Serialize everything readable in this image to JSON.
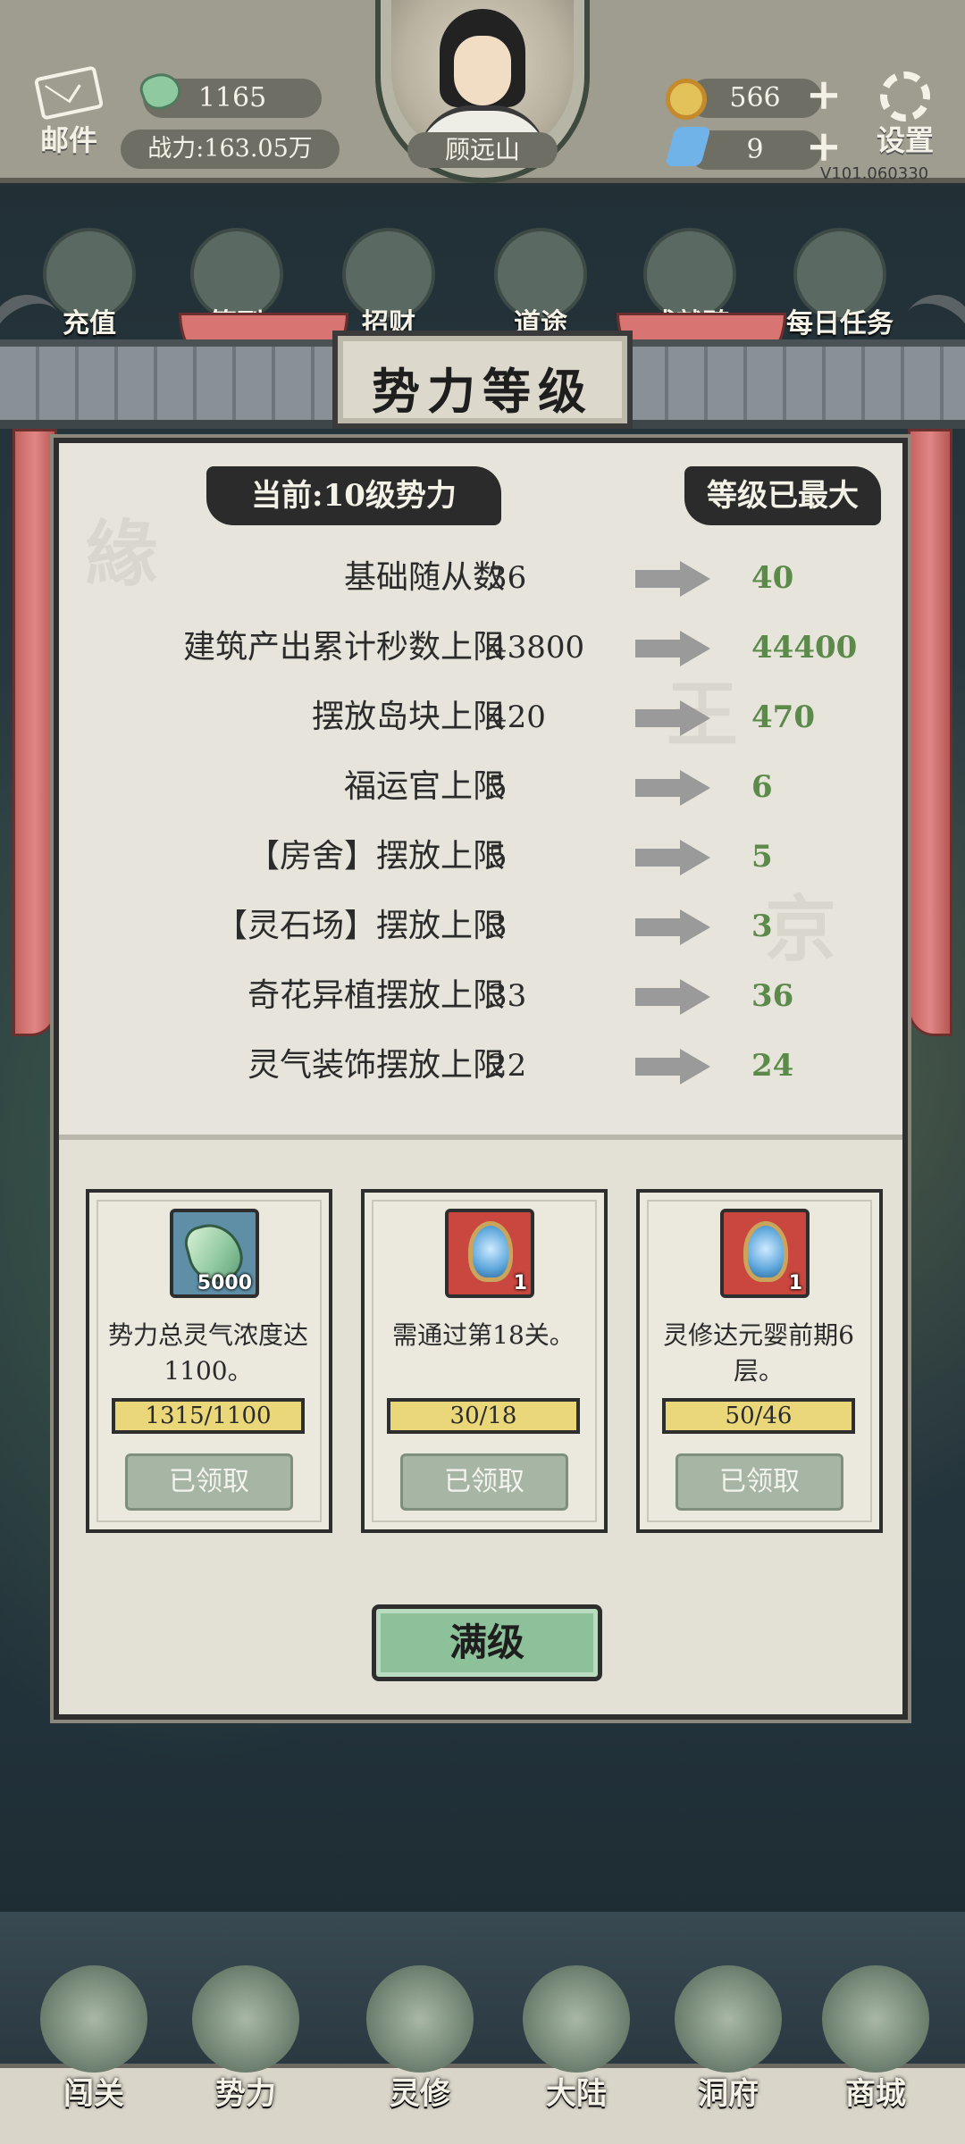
{
  "header": {
    "mail_label": "邮件",
    "jade_count": "1165",
    "power_text": "战力:163.05万",
    "player_name": "顾远山",
    "coin_count": "566",
    "energy_count": "9",
    "settings_label": "设置",
    "version": "V101.060330"
  },
  "activities": [
    {
      "label": "充值"
    },
    {
      "label": "签到"
    },
    {
      "label": "招财"
    },
    {
      "label": "道途"
    },
    {
      "label": "成就碑"
    },
    {
      "label": "每日任务"
    }
  ],
  "modal": {
    "title": "势力等级",
    "current_label": "当前:10级势力",
    "maxed_label": "等级已最大",
    "stats": [
      {
        "name": "基础随从数",
        "current": "36",
        "next": "40"
      },
      {
        "name": "建筑产出累计秒数上限",
        "current": "43800",
        "next": "44400"
      },
      {
        "name": "摆放岛块上限",
        "current": "420",
        "next": "470"
      },
      {
        "name": "福运官上限",
        "current": "5",
        "next": "6"
      },
      {
        "name": "【房舍】摆放上限",
        "current": "5",
        "next": "5"
      },
      {
        "name": "【灵石场】摆放上限",
        "current": "3",
        "next": "3"
      },
      {
        "name": "奇花异植摆放上限",
        "current": "33",
        "next": "36"
      },
      {
        "name": "灵气装饰摆放上限",
        "current": "22",
        "next": "24"
      }
    ],
    "rewards": [
      {
        "item_icon": "jade-item-icon",
        "quantity": "5000",
        "desc": "势力总灵气浓度达1100。",
        "progress": "1315/1100",
        "progress_fraction": 1.0,
        "button": "已领取"
      },
      {
        "item_icon": "mirror-item-icon",
        "quantity": "1",
        "desc": "需通过第18关。",
        "progress": "30/18",
        "progress_fraction": 1.0,
        "button": "已领取"
      },
      {
        "item_icon": "mirror-item-icon",
        "quantity": "1",
        "desc": "灵修达元婴前期6层。",
        "progress": "50/46",
        "progress_fraction": 1.0,
        "button": "已领取"
      }
    ],
    "max_button": "满级"
  },
  "bottom_nav": [
    {
      "label": "闯关"
    },
    {
      "label": "势力"
    },
    {
      "label": "灵修"
    },
    {
      "label": "大陆"
    },
    {
      "label": "洞府"
    },
    {
      "label": "商城"
    }
  ],
  "colors": {
    "next_value": "#5c8a4a",
    "max_button": "#8dc19a",
    "claimed_button": "#a6b5a4",
    "curtain": "#d87573"
  }
}
